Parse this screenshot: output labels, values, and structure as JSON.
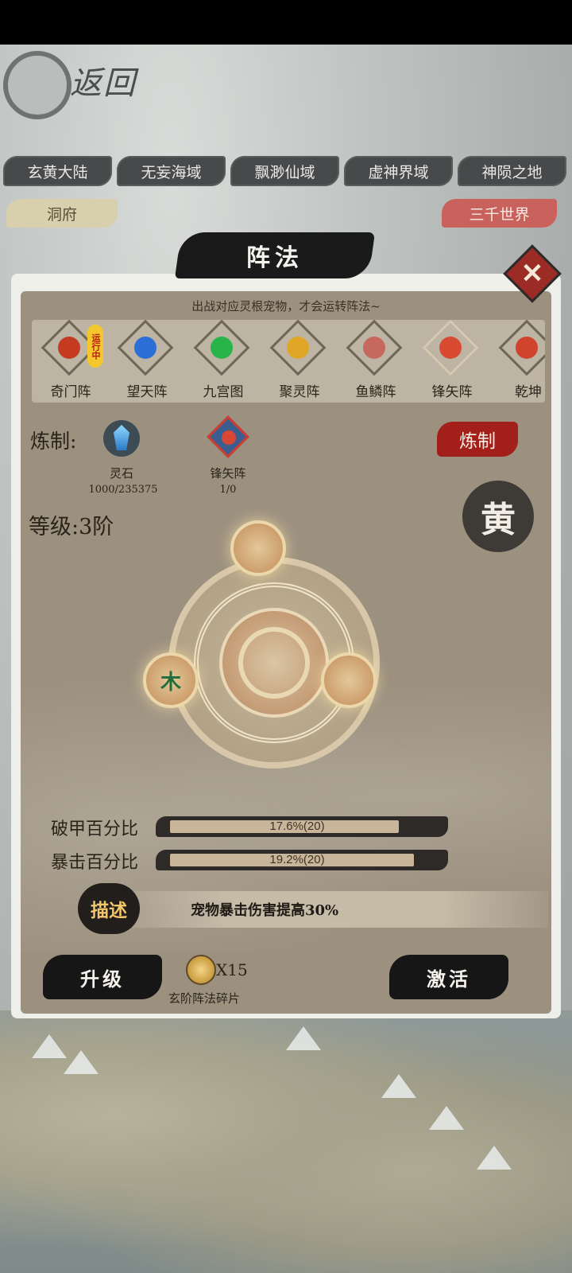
{
  "logo": {
    "text": "返回"
  },
  "regions": [
    "玄黄大陆",
    "无妄海域",
    "飘渺仙域",
    "虚神界域",
    "神陨之地"
  ],
  "cave_label": "洞府",
  "world_label": "三千世界",
  "panel": {
    "title": "阵法",
    "hint": "出战对应灵根宠物，才会运转阵法~"
  },
  "formations": [
    {
      "name": "奇门阵",
      "color": "#c43b22",
      "active": true
    },
    {
      "name": "望天阵",
      "color": "#2b6fd6",
      "active": false
    },
    {
      "name": "九宫图",
      "color": "#27b54a",
      "active": false
    },
    {
      "name": "聚灵阵",
      "color": "#e0a726",
      "active": false
    },
    {
      "name": "鱼鳞阵",
      "color": "#c7685e",
      "active": false
    },
    {
      "name": "锋矢阵",
      "color": "#d94a33",
      "active": false
    },
    {
      "name": "乾坤",
      "color": "#d0432c",
      "active": false
    }
  ],
  "active_tag": "运行中",
  "refine": {
    "label": "炼制:",
    "stone_name": "灵石",
    "stone_count": "1000/235375",
    "fragment_name": "锋矢阵",
    "fragment_count": "1/0",
    "button": "炼制"
  },
  "grade": "黄",
  "level": "等级:3阶",
  "diagram": {
    "node_wood": "木"
  },
  "stats": [
    {
      "label": "破甲百分比",
      "value": "17.6%(20)",
      "fill": 0.9
    },
    {
      "label": "暴击百分比",
      "value": "19.2%(20)",
      "fill": 0.96
    }
  ],
  "description": {
    "badge": "描述",
    "text": "宠物暴击伤害提高30%"
  },
  "upgrade_button": "升级",
  "activate_button": "激活",
  "cost": {
    "qty": "X15",
    "name": "玄阶阵法碎片"
  }
}
